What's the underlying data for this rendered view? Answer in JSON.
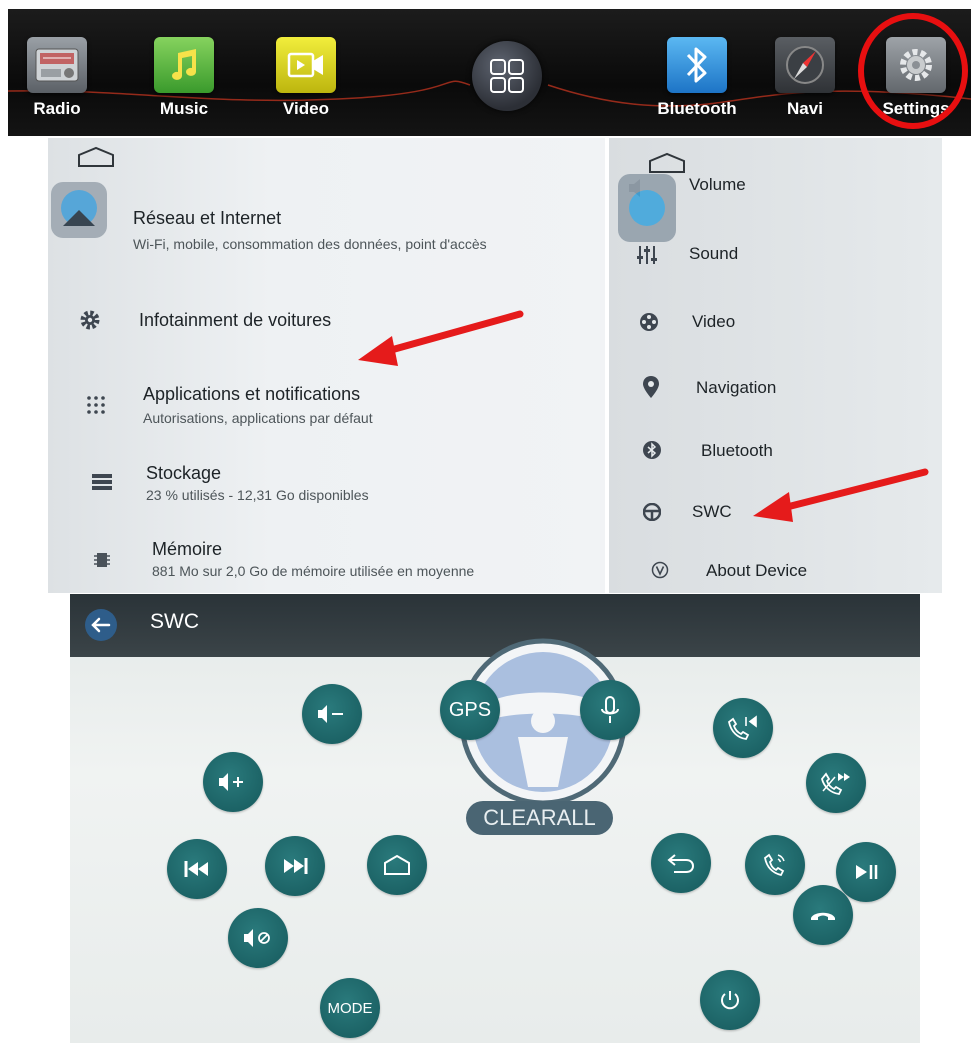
{
  "launcher": {
    "apps": [
      {
        "id": "radio",
        "label": "Radio",
        "icon": "radio-icon"
      },
      {
        "id": "music",
        "label": "Music",
        "icon": "music-note-icon"
      },
      {
        "id": "video",
        "label": "Video",
        "icon": "video-icon"
      },
      {
        "id": "bluetooth",
        "label": "Bluetooth",
        "icon": "bluetooth-icon"
      },
      {
        "id": "navi",
        "label": "Navi",
        "icon": "compass-icon"
      },
      {
        "id": "settings",
        "label": "Settings",
        "icon": "gear-icon"
      }
    ],
    "highlight_color": "#e80f10"
  },
  "settings_left": {
    "items": [
      {
        "title": "Réseau et Internet",
        "subtitle": "Wi-Fi, mobile, consommation des données, point d'accès",
        "icon": "wifi-icon"
      },
      {
        "title": "Infotainment de voitures",
        "subtitle": "",
        "icon": "gear-icon"
      },
      {
        "title": "Applications et notifications",
        "subtitle": "Autorisations, applications par défaut",
        "icon": "apps-grid-icon"
      },
      {
        "title": "Stockage",
        "subtitle": "23 % utilisés - 12,31 Go disponibles",
        "icon": "storage-icon"
      },
      {
        "title": "Mémoire",
        "subtitle": "881 Mo sur 2,0 Go de mémoire utilisée en moyenne",
        "icon": "memory-icon"
      }
    ]
  },
  "settings_right": {
    "items": [
      {
        "title": "Volume",
        "icon": "speaker-icon"
      },
      {
        "title": "Sound",
        "icon": "equalizer-icon"
      },
      {
        "title": "Video",
        "icon": "film-reel-icon"
      },
      {
        "title": "Navigation",
        "icon": "location-pin-icon"
      },
      {
        "title": "Bluetooth",
        "icon": "bluetooth-icon"
      },
      {
        "title": "SWC",
        "icon": "steering-wheel-icon"
      },
      {
        "title": "About Device",
        "icon": "about-icon"
      }
    ]
  },
  "swc": {
    "title": "SWC",
    "buttons": {
      "gps": "GPS",
      "mode": "MODE"
    },
    "clear_all": "CLEARALL",
    "accent": "#1d6567"
  },
  "annotation": {
    "arrow_color": "#e51b1b"
  }
}
